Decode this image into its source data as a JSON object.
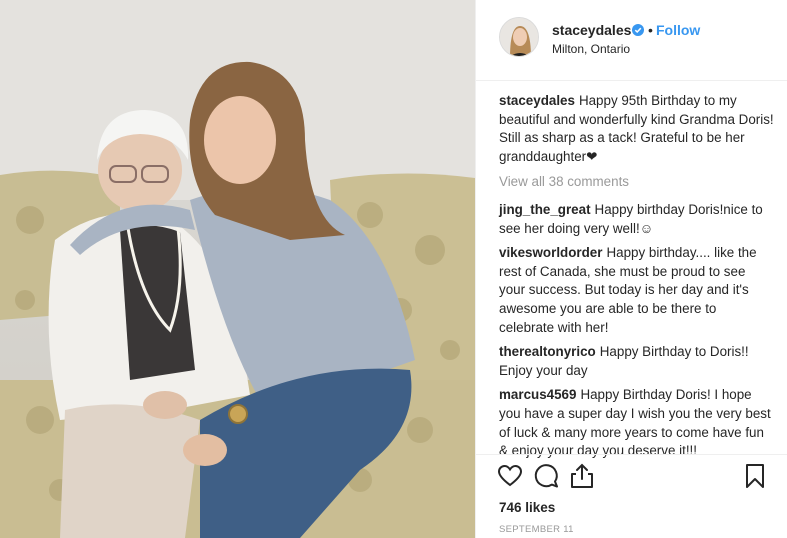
{
  "post": {
    "author": {
      "username": "staceydales",
      "verified_icon": "verified-badge-icon",
      "separator": "•",
      "follow_label": "Follow",
      "location": "Milton, Ontario"
    },
    "caption": {
      "username": "staceydales",
      "text": "Happy 95th Birthday to my beautiful and wonderfully kind Grandma Doris! Still as sharp as a tack! Grateful to be her granddaughter❤"
    },
    "view_all_comments": "View all 38 comments",
    "comments": [
      {
        "username": "jing_the_great",
        "text": "Happy birthday Doris!nice to see her doing very well!☺"
      },
      {
        "username": "vikesworldorder",
        "text": "Happy birthday.... like the rest of Canada, she must be proud to see your success. But today is her day and it's awesome you are able to be there to celebrate with her!"
      },
      {
        "username": "therealtonyrico",
        "text": "Happy Birthday to Doris!! Enjoy your day"
      },
      {
        "username": "marcus4569",
        "text": "Happy Birthday Doris! I hope you have a super day I wish you the very best of luck & many more years to come have fun & enjoy your day you deserve it!!!"
      }
    ],
    "actions": {
      "like_icon": "heart-icon",
      "comment_icon": "comment-bubble-icon",
      "share_icon": "share-icon",
      "save_icon": "bookmark-icon"
    },
    "likes": "746 likes",
    "date": "SEPTEMBER 11"
  },
  "colors": {
    "link_blue": "#3897f0",
    "muted_gray": "#999999",
    "text": "#262626",
    "border": "#efefef"
  }
}
